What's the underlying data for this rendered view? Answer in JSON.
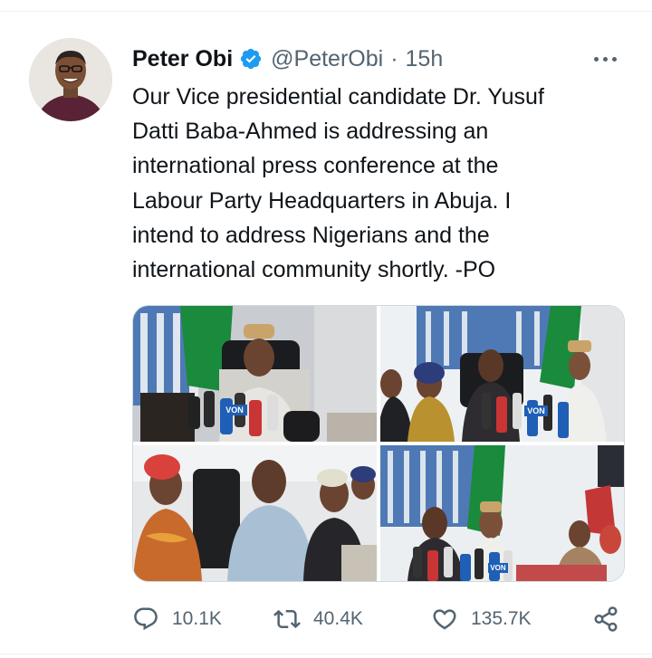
{
  "tweet": {
    "author": {
      "name": "Peter Obi",
      "handle": "@PeterObi",
      "separator": "·",
      "time": "15h"
    },
    "text_lines": [
      "Our Vice presidential candidate Dr. Yusuf",
      "Datti Baba-Ahmed is addressing an",
      "international press conference at the",
      "Labour Party Headquarters in Abuja. I",
      "intend to address Nigerians and the",
      "international community shortly. -PO"
    ],
    "media_labels": [
      "VON",
      "VON",
      "VON"
    ],
    "stats": {
      "replies": "10.1K",
      "reposts": "40.4K",
      "likes": "135.7K"
    }
  },
  "icons": {
    "verified": "verified-badge-icon",
    "more": "more-dots-icon",
    "reply": "reply-icon",
    "repost": "repost-icon",
    "like": "heart-icon",
    "share": "share-icon"
  },
  "colors": {
    "verified": "#1d9bf0",
    "text": "#0f1419",
    "muted": "#536471",
    "flag_green": "#1a8a3c"
  }
}
